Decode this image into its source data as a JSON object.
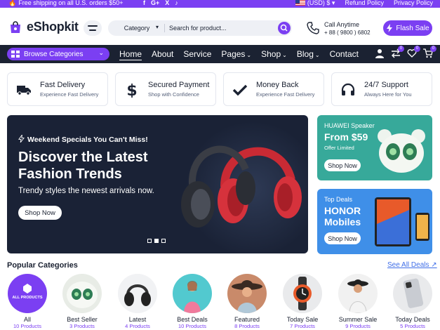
{
  "topbar": {
    "shipping": "Free shipping on all U.S. orders $50+",
    "social": [
      "f",
      "G+",
      "X",
      "♪"
    ],
    "currency": "(USD) $",
    "links": [
      "Refund Policy",
      "Privacy Policy"
    ]
  },
  "header": {
    "brand": "eShopkit",
    "category_label": "Category",
    "search_placeholder": "Search for product...",
    "call_label": "Call Anytime",
    "call_number": "+ 88 ( 9800 ) 6802",
    "flash_sale": "Flash Sale"
  },
  "nav": {
    "browse": "Browse Categories",
    "links": [
      "Home",
      "About",
      "Service",
      "Pages",
      "Shop",
      "Blog",
      "Contact"
    ],
    "badges": {
      "compare": "0",
      "wishlist": "0",
      "cart": "0"
    }
  },
  "features": [
    {
      "title": "Fast Delivery",
      "subtitle": "Experience Fast Delivery",
      "icon": "truck-icon"
    },
    {
      "title": "Secured Payment",
      "subtitle": "Shop with Confidence",
      "icon": "dollar-icon"
    },
    {
      "title": "Money Back",
      "subtitle": "Experience Fast Delivery",
      "icon": "check-icon"
    },
    {
      "title": "24/7 Support",
      "subtitle": "Always Here for You",
      "icon": "headset-icon"
    }
  ],
  "hero": {
    "kicker": "Weekend Specials You Can't Miss!",
    "title": "Discover the Latest Fashion Trends",
    "subtitle": "Trendy styles the newest arrivals now.",
    "button": "Shop Now",
    "slides": 3,
    "active_slide": 2
  },
  "banners": [
    {
      "kicker": "HUAWEI Speaker",
      "headline": "From $59",
      "note": "Offer Limited",
      "button": "Shop Now",
      "color": "#37a99a"
    },
    {
      "kicker": "Top Deals",
      "headline": "HONOR Mobiles",
      "button": "Shop Now",
      "color": "#3f8fe8"
    }
  ],
  "categories": {
    "title": "Popular Categories",
    "see_all": "See All Deals",
    "items": [
      {
        "name": "All",
        "count": "10 Products",
        "badge": "ALL PRODUCTS"
      },
      {
        "name": "Best Seller",
        "count": "3 Products"
      },
      {
        "name": "Latest",
        "count": "4 Products"
      },
      {
        "name": "Best Deals",
        "count": "10 Products"
      },
      {
        "name": "Featured",
        "count": "8 Products"
      },
      {
        "name": "Today Sale",
        "count": "7 Products"
      },
      {
        "name": "Summer Sale",
        "count": "9 Products"
      },
      {
        "name": "Today Deals",
        "count": "5 Products"
      }
    ]
  },
  "colors": {
    "accent": "#7b3ff2",
    "dark": "#1b2232",
    "teal": "#37a99a",
    "blue": "#3f8fe8"
  }
}
